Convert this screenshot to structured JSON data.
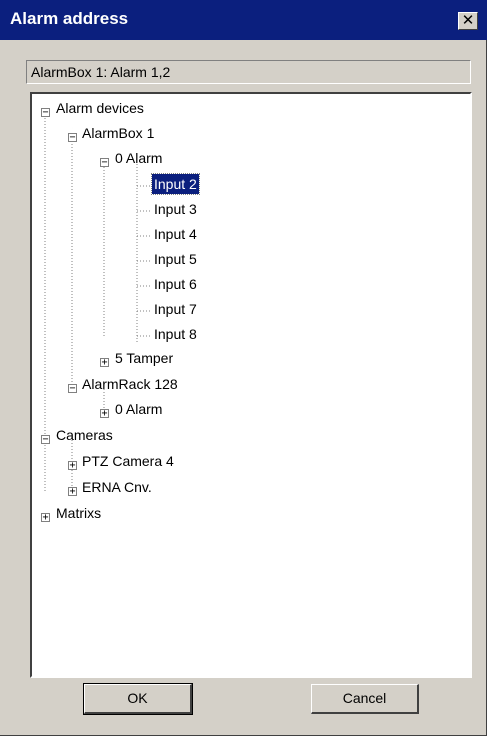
{
  "window": {
    "title": "Alarm address",
    "close_glyph": "✕",
    "icons": {
      "close": "close-icon"
    }
  },
  "address_field": {
    "value": "AlarmBox 1: Alarm 1,2"
  },
  "tree": {
    "alarm_devices": "Alarm devices",
    "alarmbox_1": "AlarmBox 1",
    "alarm_0": "0 Alarm",
    "inputs": [
      "Input 2",
      "Input 3",
      "Input 4",
      "Input 5",
      "Input 6",
      "Input 7",
      "Input 8"
    ],
    "selected_input": "Input 2",
    "tamper_5": "5 Tamper",
    "alarmrack_128": "AlarmRack 128",
    "alarmrack_alarm_0": "0 Alarm",
    "cameras": "Cameras",
    "ptz_camera_4": "PTZ Camera 4",
    "erna_cnv": "ERNA Cnv.",
    "matrixs": "Matrixs",
    "expanded_glyph": "−",
    "collapsed_glyph": "+"
  },
  "buttons": {
    "ok": "OK",
    "cancel": "Cancel"
  },
  "colors": {
    "title_bar": "#0b1f7e",
    "dialog_face": "#d4d0c8",
    "selection": "#0b1f7e"
  }
}
